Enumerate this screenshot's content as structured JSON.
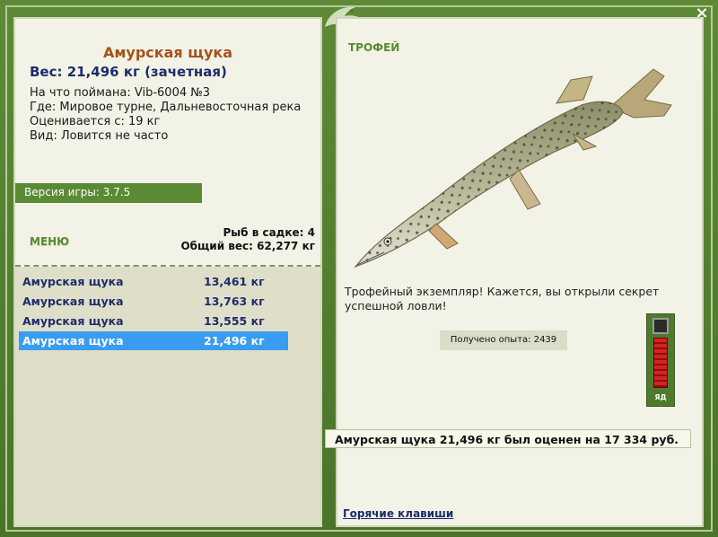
{
  "fish": {
    "name": "Амурская щука",
    "weight_line": "Вес: 21,496 кг (зачетная)",
    "caught_on": "На что поймана: Vib-6004 №3",
    "location": "Где: Мировое турне, Дальневосточная река",
    "rated_from": "Оценивается с: 19 кг",
    "kind": "Вид: Ловится не часто"
  },
  "version": "Версия игры: 3.7.5",
  "menu": {
    "label": "МЕНЮ"
  },
  "cage": {
    "count": "Рыб в садке: 4",
    "total_weight": "Общий вес: 62,277 кг"
  },
  "catches": [
    {
      "name": "Амурская щука",
      "weight": "13,461 кг"
    },
    {
      "name": "Амурская щука",
      "weight": "13,763 кг"
    },
    {
      "name": "Амурская щука",
      "weight": "13,555 кг"
    },
    {
      "name": "Амурская щука",
      "weight": "21,496 кг"
    }
  ],
  "selected_catch_index": 3,
  "trophy": {
    "label": "ТРОФЕЙ",
    "text": "Трофейный экземпляр! Кажется, вы открыли секрет успешной ловли!",
    "xp": "Получено опыта: 2439"
  },
  "meter": {
    "label": "ЯД"
  },
  "result": "Амурская щука 21,496 кг был оценен на 17 334 руб.",
  "hotkeys": "Горячие клавиши",
  "close": "×",
  "colors": {
    "frame": "#4f7a2e",
    "panel": "#f2f2e6",
    "selected_row": "#3a9cf1",
    "title_brown": "#a5521c",
    "link_blue": "#1d2c6b"
  },
  "icons": [
    "fish-logo-icon",
    "close-icon",
    "pike-fish-image"
  ]
}
